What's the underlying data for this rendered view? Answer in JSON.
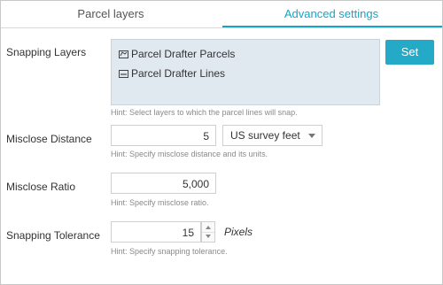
{
  "tabs": {
    "parcel_layers": "Parcel layers",
    "advanced_settings": "Advanced settings",
    "active_color": "#1aa3c4"
  },
  "snapping_layers": {
    "label": "Snapping Layers",
    "items": [
      {
        "name": "Parcel Drafter Parcels",
        "icon": "polygon-layer-icon"
      },
      {
        "name": "Parcel Drafter Lines",
        "icon": "line-layer-icon"
      }
    ],
    "hint": "Hint: Select layers to which the parcel lines will snap.",
    "set_button": "Set"
  },
  "misclose_distance": {
    "label": "Misclose Distance",
    "value": "5",
    "unit_selected": "US survey feet",
    "hint": "Hint: Specify misclose distance and its units."
  },
  "misclose_ratio": {
    "label": "Misclose Ratio",
    "value": "5,000",
    "hint": "Hint: Specify misclose ratio."
  },
  "snapping_tolerance": {
    "label": "Snapping Tolerance",
    "value": "15",
    "units": "Pixels",
    "hint": "Hint: Specify snapping tolerance."
  },
  "colors": {
    "accent": "#24a9c6",
    "layers_box_bg": "#e1e9f0"
  }
}
